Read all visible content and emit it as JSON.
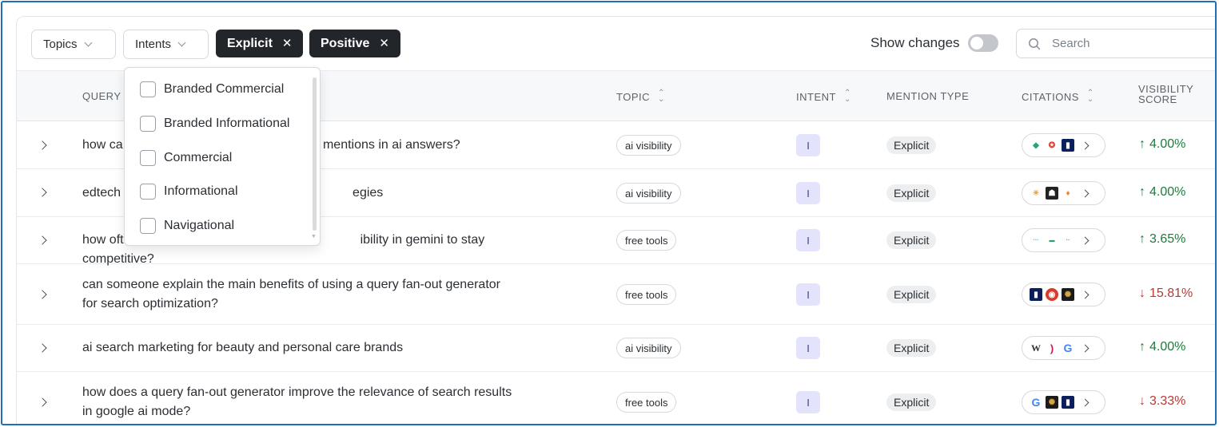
{
  "filters": {
    "topics_label": "Topics",
    "intents_label": "Intents",
    "active": [
      {
        "label": "Explicit"
      },
      {
        "label": "Positive"
      }
    ],
    "show_changes_label": "Show changes",
    "show_changes_on": false,
    "search_placeholder": "Search"
  },
  "intents_dropdown": {
    "options": [
      {
        "label": "Branded Commercial",
        "checked": false
      },
      {
        "label": "Branded Informational",
        "checked": false
      },
      {
        "label": "Commercial",
        "checked": false
      },
      {
        "label": "Informational",
        "checked": false
      },
      {
        "label": "Navigational",
        "checked": false
      }
    ]
  },
  "table": {
    "headers": {
      "query": "QUERY",
      "topic": "TOPIC",
      "intent": "INTENT",
      "mention_type": "MENTION TYPE",
      "citations": "CITATIONS",
      "visibility_score": "VISIBILITY SCORE"
    },
    "rows": [
      {
        "query_visible_start": "how ca",
        "query_visible_end": "t brand mentions in ai answers?",
        "topic": "ai visibility",
        "intent": "I",
        "mention_type": "Explicit",
        "citations": [
          "diamond-logo",
          "red-logo",
          "blue-logo"
        ],
        "score": "4.00%",
        "direction": "up",
        "direction_icon": "↑"
      },
      {
        "query_visible_start": "edtech",
        "query_visible_end": "egies",
        "topic": "ai visibility",
        "intent": "I",
        "mention_type": "Explicit",
        "citations": [
          "sun-logo",
          "dark-logo",
          "flame-logo"
        ],
        "score": "4.00%",
        "direction": "up",
        "direction_icon": "↑"
      },
      {
        "query_visible_start": "how oft",
        "query_visible_end": "ibility in gemini to stay competitive?",
        "topic": "free tools",
        "intent": "I",
        "mention_type": "Explicit",
        "citations": [
          "text-logo-1",
          "text-logo-2",
          "text-logo-3"
        ],
        "score": "3.65%",
        "direction": "up",
        "direction_icon": "↑"
      },
      {
        "query_line1": "can someone explain the main benefits of using a query fan-out generator",
        "query_line2": "for search optimization?",
        "topic": "free tools",
        "intent": "I",
        "mention_type": "Explicit",
        "citations": [
          "blue-logo",
          "red-face-logo",
          "gold-logo"
        ],
        "score": "15.81%",
        "direction": "down",
        "direction_icon": "↓"
      },
      {
        "query_line1": "ai search marketing for beauty and personal care brands",
        "topic": "ai visibility",
        "intent": "I",
        "mention_type": "Explicit",
        "citations": [
          "w-logo",
          "ribbon-logo",
          "google-logo"
        ],
        "score": "4.00%",
        "direction": "up",
        "direction_icon": "↑"
      },
      {
        "query_line1": "how does a query fan-out generator improve the relevance of search results",
        "query_line2": "in google ai mode?",
        "topic": "free tools",
        "intent": "I",
        "mention_type": "Explicit",
        "citations": [
          "google-logo",
          "gold-logo",
          "blue-logo"
        ],
        "score": "3.33%",
        "direction": "down",
        "direction_icon": "↓"
      }
    ]
  },
  "colors": {
    "up": "#1f7a3e",
    "down": "#b63a36",
    "intent_badge_bg": "#e3e4fb",
    "active_filter_bg": "#22262b",
    "frame_border": "#1f6fb8"
  }
}
